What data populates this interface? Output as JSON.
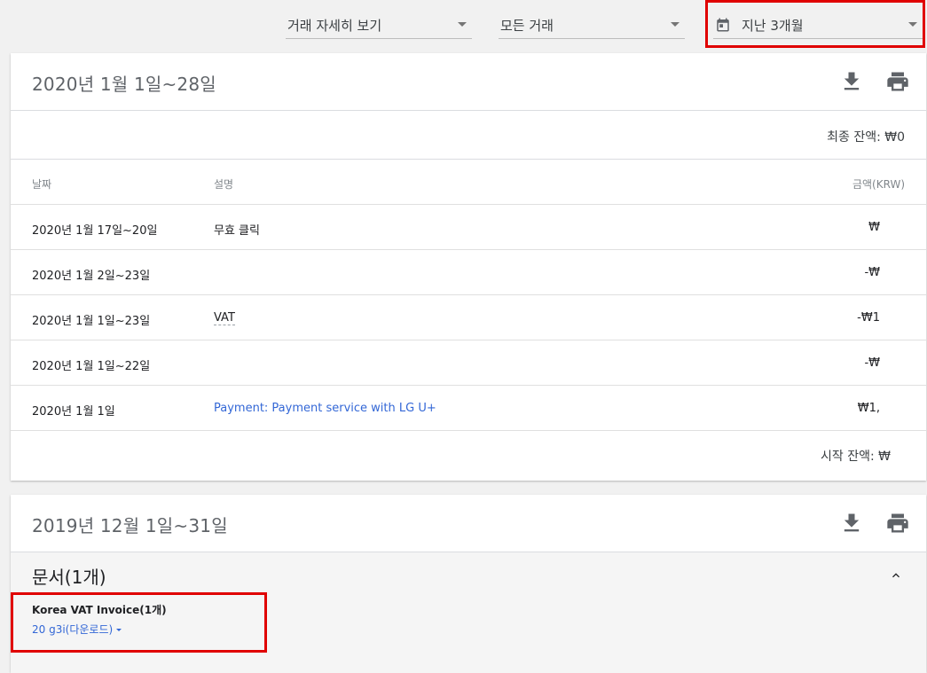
{
  "filters": {
    "view": "거래 자세히 보기",
    "type": "모든 거래",
    "period": "지난 3개월"
  },
  "icons": {
    "calendar": "calendar-icon",
    "download": "download-icon",
    "print": "print-icon",
    "collapse": "chevron-up-icon",
    "dropdown": "triangle-down-icon"
  },
  "colors": {
    "highlight": "#e00000",
    "link": "#3367d6"
  },
  "statement1": {
    "title": "2020년 1월 1일~28일",
    "ending_balance": "최종 잔액: ₩0",
    "columns": {
      "date": "날짜",
      "description": "설명",
      "amount": "금액(KRW)"
    },
    "rows": [
      {
        "date": "2020년 1월 17일~20일",
        "description": "무효 클릭",
        "amount": "₩"
      },
      {
        "date": "2020년 1월 2일~23일",
        "description": "",
        "amount": "-₩"
      },
      {
        "date": "2020년 1월 1일~23일",
        "description": "VAT",
        "amount": "-₩1"
      },
      {
        "date": "2020년 1월 1일~22일",
        "description": "",
        "amount": "-₩"
      },
      {
        "date": "2020년 1월 1일",
        "description": "Payment: Payment service with LG U+",
        "amount": "₩1,"
      }
    ],
    "starting_balance": "시작 잔액: ₩"
  },
  "statement2": {
    "title": "2019년 12월 1일~31일",
    "documents_title": "문서(1개)",
    "invoice_title": "Korea VAT Invoice(1개)",
    "invoice_link": "20                    g3i(다운로드)"
  }
}
